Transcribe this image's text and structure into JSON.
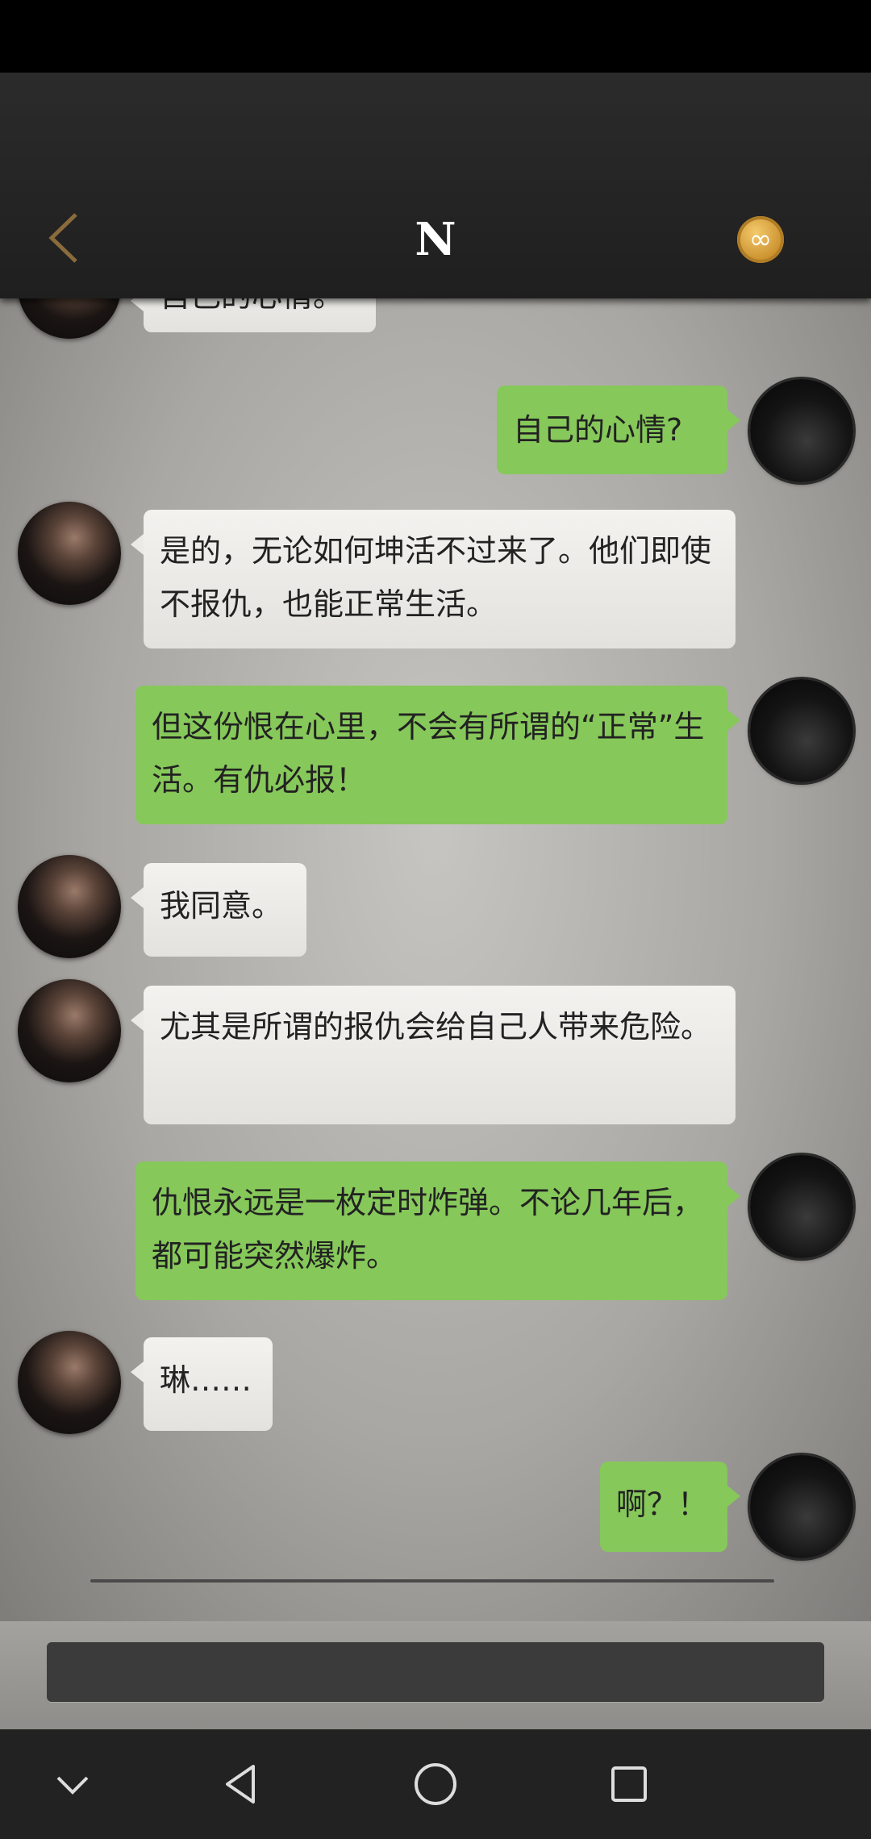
{
  "header": {
    "title": "N",
    "coin_symbol": "∞"
  },
  "messages": [
    {
      "side": "left",
      "text": "自己的心情。"
    },
    {
      "side": "right",
      "text": "自己的心情?"
    },
    {
      "side": "left",
      "text": "是的，无论如何坤活不过来了。他们即使不报仇，也能正常生活。"
    },
    {
      "side": "right",
      "text": "但这份恨在心里，不会有所谓的“正常”生活。有仇必报！"
    },
    {
      "side": "left",
      "text": "我同意。"
    },
    {
      "side": "left",
      "text": "尤其是所谓的报仇会给自己人带来危险。"
    },
    {
      "side": "right",
      "text": "仇恨永远是一枚定时炸弹。不论几年后，都可能突然爆炸。"
    },
    {
      "side": "left",
      "text": "琳……"
    },
    {
      "side": "right",
      "text": "啊？！"
    }
  ],
  "colors": {
    "right_bubble": "#86c85a",
    "left_bubble": "#ebeae6",
    "header": "#262626"
  },
  "icons": {
    "back": "chevron-left-icon",
    "coin": "infinity-coin-icon",
    "nav": [
      "chevron-down-icon",
      "back-triangle-icon",
      "home-circle-icon",
      "recents-square-icon"
    ]
  }
}
